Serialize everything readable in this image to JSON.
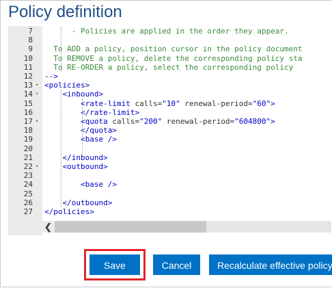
{
  "title": "Policy definition",
  "editor": {
    "lines": [
      {
        "num": "7",
        "fold": "",
        "text": "      - Policies are applied in the order they appear.",
        "kind": "comment"
      },
      {
        "num": "8",
        "fold": "",
        "text": "",
        "kind": "comment"
      },
      {
        "num": "9",
        "fold": "",
        "text": "  To ADD a policy, position cursor in the policy document",
        "kind": "comment"
      },
      {
        "num": "10",
        "fold": "",
        "text": "  To REMOVE a policy, delete the corresponding policy sta",
        "kind": "comment"
      },
      {
        "num": "11",
        "fold": "",
        "text": "  To RE-ORDER a policy, select the corresponding policy",
        "kind": "comment"
      },
      {
        "num": "12",
        "fold": "",
        "text": "-->",
        "kind": "tag"
      },
      {
        "num": "13",
        "fold": "▾",
        "text": "<policies>",
        "kind": "tag"
      },
      {
        "num": "14",
        "fold": "▾",
        "text": "    <inbound>",
        "kind": "tag"
      },
      {
        "num": "15",
        "fold": "",
        "text": "        <rate-limit calls=\"10\" renewal-period=\"60\">",
        "kind": "tag"
      },
      {
        "num": "16",
        "fold": "",
        "text": "        </rate-limit>",
        "kind": "tag"
      },
      {
        "num": "17",
        "fold": "▾",
        "text": "        <quota calls=\"200\" renewal-period=\"604800\">",
        "kind": "tag"
      },
      {
        "num": "18",
        "fold": "",
        "text": "        </quota>",
        "kind": "tag"
      },
      {
        "num": "19",
        "fold": "",
        "text": "        <base />",
        "kind": "tag"
      },
      {
        "num": "20",
        "fold": "",
        "text": "",
        "kind": "tag"
      },
      {
        "num": "21",
        "fold": "",
        "text": "    </inbound>",
        "kind": "tag"
      },
      {
        "num": "22",
        "fold": "▾",
        "text": "    <outbound>",
        "kind": "tag"
      },
      {
        "num": "23",
        "fold": "",
        "text": "",
        "kind": "tag"
      },
      {
        "num": "24",
        "fold": "",
        "text": "        <base />",
        "kind": "tag"
      },
      {
        "num": "25",
        "fold": "",
        "text": "",
        "kind": "tag"
      },
      {
        "num": "26",
        "fold": "",
        "text": "    </outbound>",
        "kind": "tag"
      },
      {
        "num": "27",
        "fold": "",
        "text": "</policies>",
        "kind": "tag"
      }
    ],
    "scroll_left_glyph": "❮"
  },
  "buttons": {
    "save": "Save",
    "cancel": "Cancel",
    "recalculate": "Recalculate effective policy"
  },
  "colors": {
    "accent": "#0072c6",
    "highlight": "#e0262e",
    "comment": "#3a8a3a",
    "tag": "#0000c8"
  }
}
